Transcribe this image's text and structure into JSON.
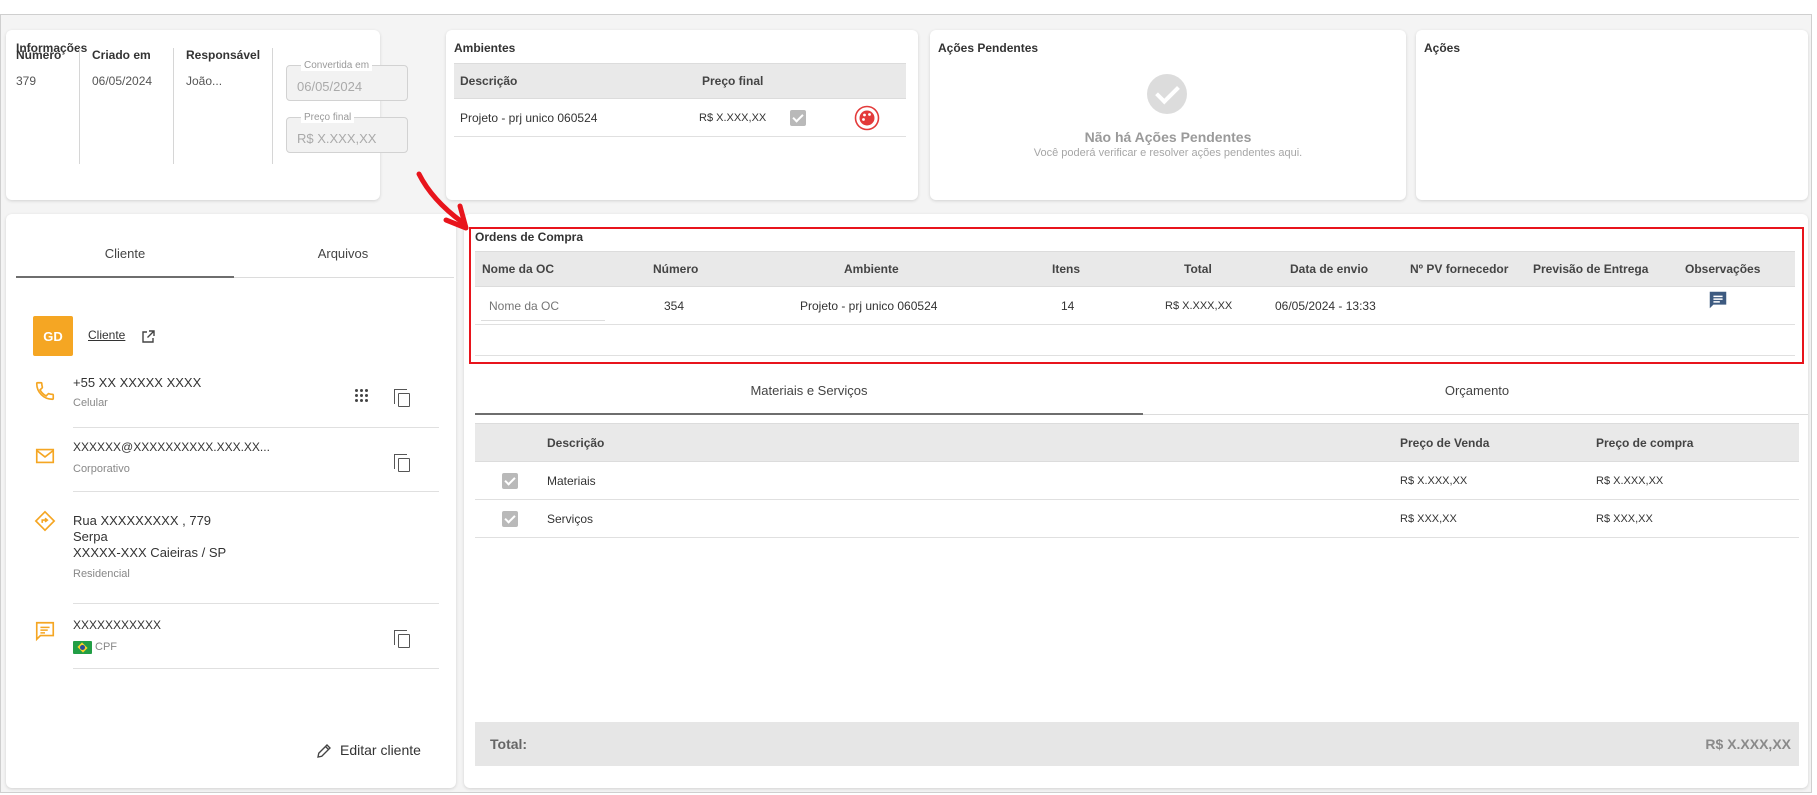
{
  "info": {
    "title": "Informações",
    "numero_label": "Número",
    "numero_value": "379",
    "criado_label": "Criado em",
    "criado_value": "06/05/2024",
    "responsavel_label": "Responsável",
    "responsavel_value": "João...",
    "convertida_label": "Convertida em",
    "convertida_value": "06/05/2024",
    "preco_label": "Preço final",
    "preco_value": "R$ X.XXX,XX"
  },
  "ambientes": {
    "title": "Ambientes",
    "headers": [
      "Descrição",
      "Preço final"
    ],
    "rows": [
      {
        "descricao": "Projeto - prj unico 060524",
        "preco": "R$ X.XXX,XX"
      }
    ]
  },
  "pendentes": {
    "title": "Ações Pendentes",
    "empty_title": "Não há Ações Pendentes",
    "empty_sub": "Você poderá verificar e resolver ações pendentes aqui."
  },
  "acoes": {
    "title": "Ações"
  },
  "client_tabs": [
    "Cliente",
    "Arquivos"
  ],
  "client": {
    "avatar": "GD",
    "link": "Cliente",
    "phone": "+55 XX XXXXX XXXX",
    "phone_type": "Celular",
    "email": "XXXXXX@XXXXXXXXXX.XXX.XX...",
    "email_type": "Corporativo",
    "address_line1": "Rua XXXXXXXXX , 779",
    "address_line2": "Serpa",
    "address_line3": "XXXXX-XXX Caieiras / SP",
    "address_type": "Residencial",
    "doc": "XXXXXXXXXXX",
    "doc_type": "CPF",
    "edit_label": "Editar cliente"
  },
  "ordens": {
    "title": "Ordens de Compra",
    "headers": [
      "Nome da OC",
      "Número",
      "Ambiente",
      "Itens",
      "Total",
      "Data de envio",
      "Nº PV fornecedor",
      "Previsão de Entrega",
      "Observações"
    ],
    "input_placeholder": "Nome da OC",
    "rows": [
      {
        "numero": "354",
        "ambiente": "Projeto - prj unico 060524",
        "itens": "14",
        "total": "R$ X.XXX,XX",
        "data": "06/05/2024 - 13:33"
      }
    ]
  },
  "bottom_tabs": [
    "Materiais e Serviços",
    "Orçamento"
  ],
  "materiais": {
    "headers": [
      "Descrição",
      "Preço de Venda",
      "Preço de compra"
    ],
    "rows": [
      {
        "descricao": "Materiais",
        "venda": "R$ X.XXX,XX",
        "compra": "R$ X.XXX,XX"
      },
      {
        "descricao": "Serviços",
        "venda": "R$ XXX,XX",
        "compra": "R$ XXX,XX"
      }
    ]
  },
  "total": {
    "label": "Total:",
    "value": "R$ X.XXX,XX"
  },
  "colors": {
    "accent": "#f5a623",
    "highlight": "#e8141c",
    "danger": "#e33a3a",
    "icon_blue": "#3d5a80"
  }
}
